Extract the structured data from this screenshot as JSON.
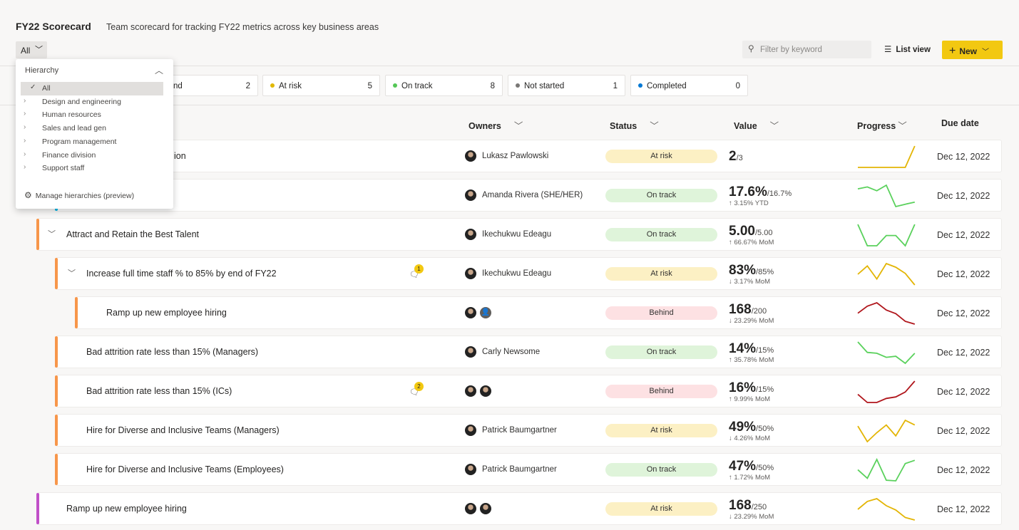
{
  "header": {
    "title": "FY22 Scorecard",
    "subtitle": "Team scorecard for tracking FY22 metrics across key business areas",
    "filter_button": "All",
    "search_placeholder": "Filter by keyword",
    "list_view": "List view",
    "new_button": "New"
  },
  "status_chips": [
    {
      "label": "Behind",
      "count": "2",
      "color": "#a4262c"
    },
    {
      "label": "At risk",
      "count": "5",
      "color": "#e1b800"
    },
    {
      "label": "On track",
      "count": "8",
      "color": "#54c756"
    },
    {
      "label": "Not started",
      "count": "1",
      "color": "#797775"
    },
    {
      "label": "Completed",
      "count": "0",
      "color": "#0078d4"
    }
  ],
  "columns": {
    "owners": "Owners",
    "status": "Status",
    "value": "Value",
    "progress": "Progress",
    "due": "Due date"
  },
  "hierarchy_dropdown": {
    "title": "Hierarchy",
    "items": [
      "All",
      "Design and engineering",
      "Human resources",
      "Sales and lead gen",
      "Program management",
      "Finance division",
      "Support staff"
    ],
    "selected": "All",
    "manage": "Manage hierarchies (preview)"
  },
  "status_colors": {
    "At risk": "#fcf0c4",
    "On track": "#dff4da",
    "Behind": "#fde1e3"
  },
  "line_colors": {
    "At risk": "#e3b505",
    "On track": "#5ad15c",
    "Behind": "#b0161c"
  },
  "rows": [
    {
      "name": "ion",
      "owners": [
        "Lukasz Pawlowski"
      ],
      "owner_label": "Lukasz Pawlowski",
      "status": "At risk",
      "value": "2",
      "target": "/3",
      "change": "",
      "due": "Dec 12, 2022",
      "trend": [
        0,
        0,
        0,
        0,
        0,
        0,
        100
      ]
    },
    {
      "name": "",
      "owners": [
        "Amanda Rivera"
      ],
      "owner_label": "Amanda Rivera (SHE/HER)",
      "status": "On track",
      "value": "17.6%",
      "target": "/16.7%",
      "change": "↑ 3.15% YTD",
      "due": "Dec 12, 2022",
      "trend": [
        83,
        92,
        74,
        100,
        0,
        11,
        21
      ]
    },
    {
      "name": "Attract and Retain the Best Talent",
      "owners": [
        "Ikechukwu Edeagu"
      ],
      "owner_label": "Ikechukwu Edeagu",
      "status": "On track",
      "value": "5.00",
      "target": "/5.00",
      "change": "↑ 66.67% MoM",
      "due": "Dec 12, 2022",
      "trend": [
        100,
        0,
        0,
        48,
        48,
        0,
        100
      ]
    },
    {
      "name": "Increase full time staff % to 85% by end of FY22",
      "comments": "1",
      "owners": [
        "Ikechukwu Edeagu"
      ],
      "owner_label": "Ikechukwu Edeagu",
      "status": "At risk",
      "value": "83%",
      "target": "/85%",
      "change": "↓ 3.17% MoM",
      "due": "Dec 12, 2022",
      "trend": [
        50,
        89,
        28,
        100,
        83,
        54,
        0
      ]
    },
    {
      "name": "Ramp up new employee hiring",
      "owners": [
        "photo",
        "generic"
      ],
      "owner_label": "",
      "status": "Behind",
      "value": "168",
      "target": "/200",
      "change": "↓ 23.29% MoM",
      "due": "Dec 12, 2022",
      "trend": [
        51,
        84,
        100,
        66,
        49,
        13,
        0
      ]
    },
    {
      "name": "Bad attrition rate less than 15% (Managers)",
      "owners": [
        "Carly Newsome"
      ],
      "owner_label": "Carly Newsome",
      "status": "On track",
      "value": "14%",
      "target": "/15%",
      "change": "↑ 35.78% MoM",
      "due": "Dec 12, 2022",
      "trend": [
        100,
        51,
        47,
        28,
        33,
        0,
        47
      ]
    },
    {
      "name": "Bad attrition rate less than 15% (ICs)",
      "comments": "2",
      "owners": [
        "photo",
        "photo"
      ],
      "owner_label": "",
      "status": "Behind",
      "value": "16%",
      "target": "/15%",
      "change": "↑ 9.99% MoM",
      "due": "Dec 12, 2022",
      "trend": [
        38,
        0,
        0,
        19,
        26,
        49,
        100
      ]
    },
    {
      "name": "Hire for Diverse and Inclusive Teams (Managers)",
      "owners": [
        "Patrick Baumgartner"
      ],
      "owner_label": "Patrick Baumgartner",
      "status": "At risk",
      "value": "49%",
      "target": "/50%",
      "change": "↓ 4.26% MoM",
      "due": "Dec 12, 2022",
      "trend": [
        73,
        0,
        42,
        78,
        27,
        100,
        78
      ]
    },
    {
      "name": "Hire for Diverse and Inclusive Teams (Employees)",
      "owners": [
        "Patrick Baumgartner"
      ],
      "owner_label": "Patrick Baumgartner",
      "status": "On track",
      "value": "47%",
      "target": "/50%",
      "change": "↑ 1.72% MoM",
      "due": "Dec 12, 2022",
      "trend": [
        52,
        12,
        100,
        3,
        0,
        81,
        96
      ]
    },
    {
      "name": "Ramp up new employee hiring",
      "owners": [
        "photo",
        "photo"
      ],
      "owner_label": "",
      "status": "At risk",
      "value": "168",
      "target": "/250",
      "change": "↓ 23.29% MoM",
      "due": "Dec 12, 2022",
      "trend": [
        50,
        87,
        100,
        67,
        47,
        12,
        0
      ]
    }
  ]
}
